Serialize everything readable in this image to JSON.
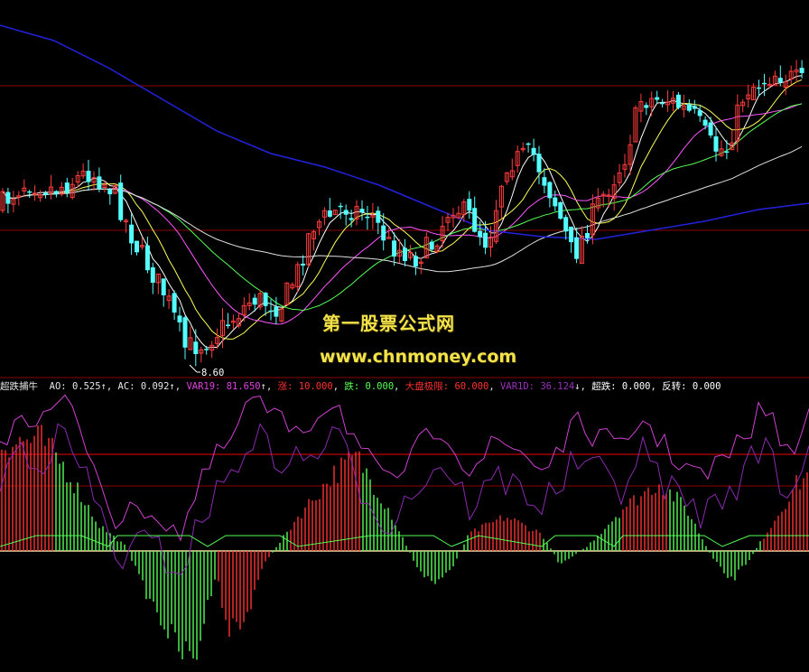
{
  "watermark": {
    "title": "第一股票公式网",
    "url": "www.chnmoney.com"
  },
  "price_panel": {
    "low_marker": "8.60"
  },
  "indicator_bar": {
    "name": "超跌捕牛",
    "ao_label": "AO:",
    "ao_value": "0.525",
    "ao_arrow": "↑",
    "ac_label": "AC:",
    "ac_value": "0.092",
    "ac_arrow": "↑",
    "var19_label": "VAR19:",
    "var19_value": "81.650",
    "var19_arrow": "↑",
    "zhang_label": "涨:",
    "zhang_value": "10.000",
    "die_label": "跌:",
    "die_value": "0.000",
    "dapan_label": "大盘极限:",
    "dapan_value": "60.000",
    "var1d_label": "VAR1D:",
    "var1d_value": "36.124",
    "var1d_arrow": "↓",
    "chaodie_label": "超跌:",
    "chaodie_value": "0.000",
    "fanzhuan_label": "反转:",
    "fanzhuan_value": "0.000"
  },
  "colors": {
    "background": "#000000",
    "candle_up": "#ff3b3b",
    "candle_down": "#54ffff",
    "ma5": "#ffffff",
    "ma10": "#ffff55",
    "ma20": "#ff55ff",
    "ma30": "#55ff55",
    "ma60": "#e0e0e0",
    "ma120": "#2222dd",
    "osc_up": "#ff3030",
    "osc_down": "#55ff55",
    "var19": "#d040d0",
    "watermark": "#f3e24a",
    "grid": "#8a0000"
  },
  "chart_data": [
    {
      "type": "candlestick",
      "series": [
        {
          "name": "price",
          "open": [],
          "high": [],
          "low": [],
          "close": []
        }
      ],
      "annotations": [
        "8.60"
      ],
      "grid": true
    },
    {
      "type": "bar",
      "series": [
        {
          "name": "AO",
          "last": 0.525
        },
        {
          "name": "AC",
          "last": 0.092
        },
        {
          "name": "VAR19",
          "last": 81.65
        },
        {
          "name": "涨",
          "last": 10.0
        },
        {
          "name": "跌",
          "last": 0.0
        },
        {
          "name": "大盘极限",
          "last": 60.0
        },
        {
          "name": "VAR1D",
          "last": 36.124
        },
        {
          "name": "超跌",
          "last": 0.0
        },
        {
          "name": "反转",
          "last": 0.0
        }
      ],
      "grid": true
    }
  ]
}
